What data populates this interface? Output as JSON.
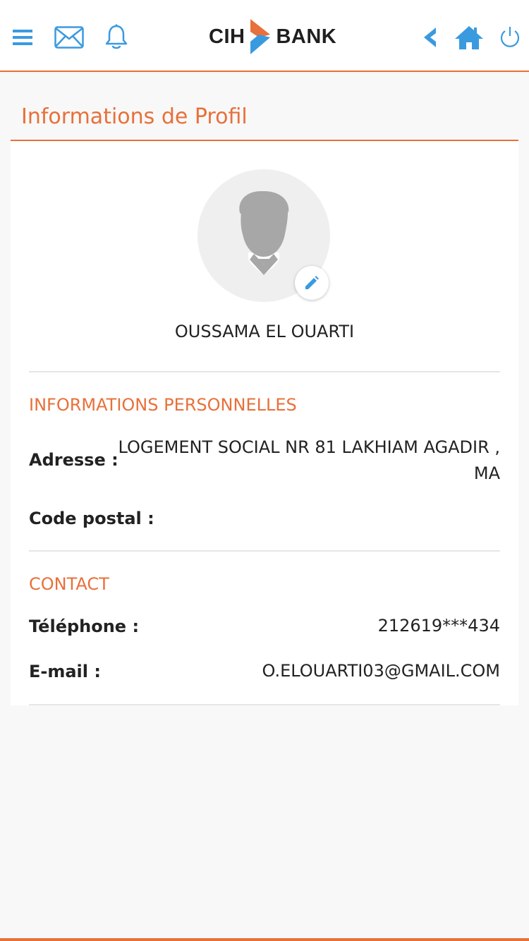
{
  "header": {
    "logo_left": "CIH",
    "logo_right": "BANK",
    "icons": [
      "menu-icon",
      "mail-icon",
      "bell-icon",
      "back-icon",
      "home-icon",
      "power-icon"
    ]
  },
  "page": {
    "title": "Informations de Profil"
  },
  "profile": {
    "name": "OUSSAMA EL OUARTI"
  },
  "personal": {
    "section_title": "INFORMATIONS PERSONNELLES",
    "address_label": "Adresse :",
    "address_line1": "LOGEMENT SOCIAL NR 81 LAKHIAM AGADIR ,",
    "address_line2": "MA",
    "postal_label": "Code postal :",
    "postal_value": ""
  },
  "contact": {
    "section_title": "CONTACT",
    "phone_label": "Téléphone :",
    "phone_value": "212619***434",
    "email_label": "E-mail :",
    "email_value": "O.ELOUARTI03@GMAIL.COM"
  },
  "colors": {
    "accent": "#e8703a",
    "icon_blue": "#3a9ae0",
    "background": "#f8f8f8"
  }
}
